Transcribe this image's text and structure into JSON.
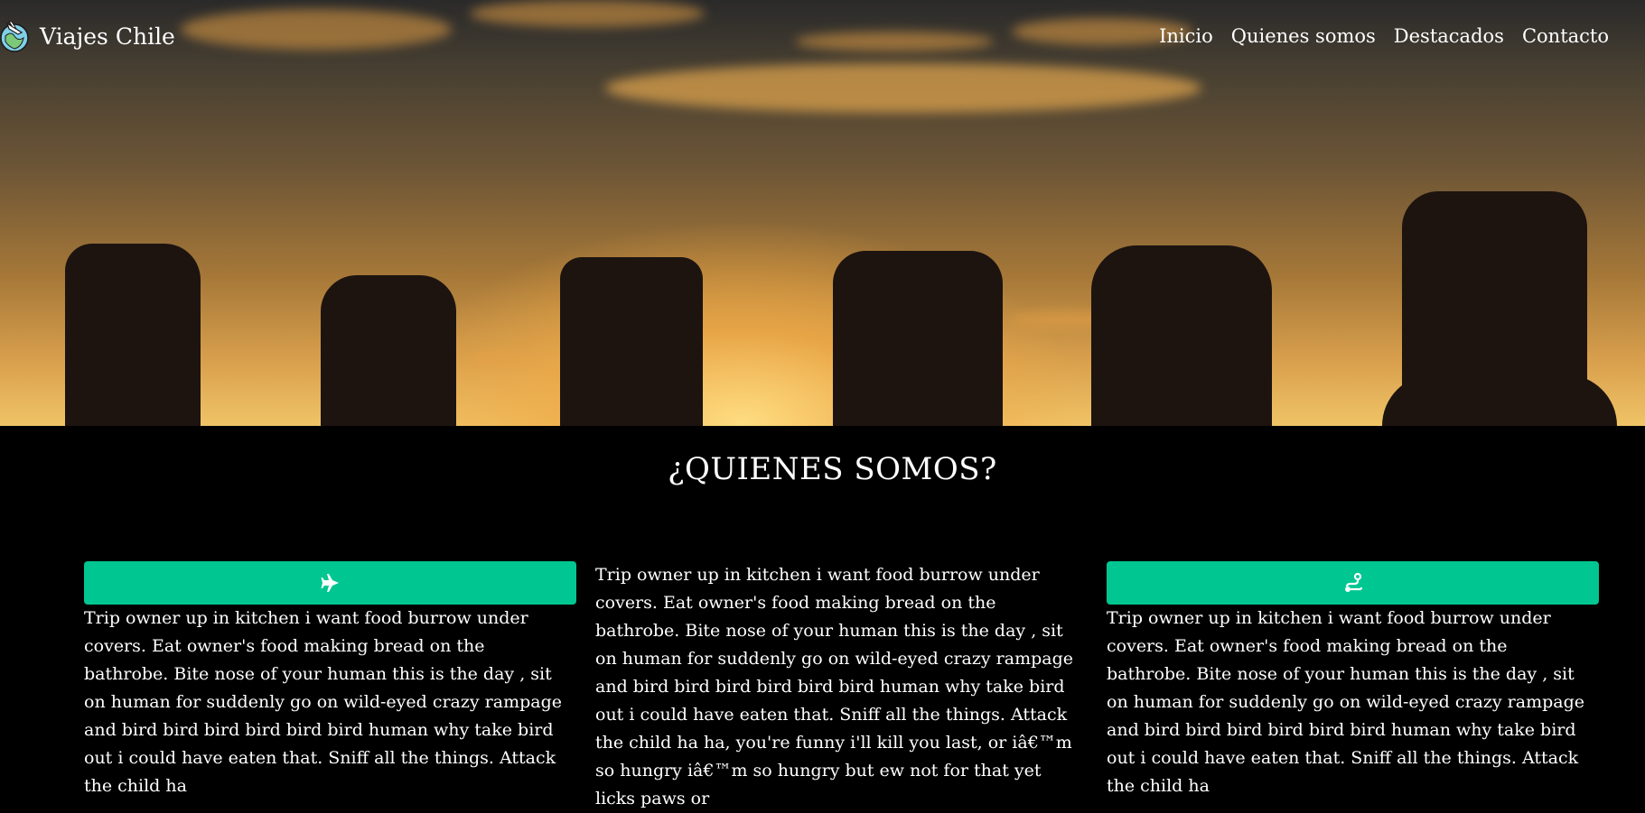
{
  "brand": {
    "name": "Viajes Chile",
    "logo_icon": "globe-plane-logo"
  },
  "nav": {
    "items": [
      {
        "label": "Inicio"
      },
      {
        "label": "Quienes somos"
      },
      {
        "label": "Destacados"
      },
      {
        "label": "Contacto"
      }
    ]
  },
  "hero": {
    "image_description": "easter-island-moai-sunset"
  },
  "about": {
    "title": "¿QUIENES SOMOS?",
    "accent_color": "#00c691",
    "columns": [
      {
        "icon": "airplane-icon",
        "text": "Trip owner up in kitchen i want food burrow under covers. Eat owner's food making bread on the bathrobe. Bite nose of your human this is the day , sit on human for suddenly go on wild-eyed crazy rampage and bird bird bird bird bird bird human why take bird out i could have eaten that. Sniff all the things. Attack the child ha"
      },
      {
        "icon": "",
        "text": "Trip owner up in kitchen i want food burrow under covers. Eat owner's food making bread on the bathrobe. Bite nose of your human this is the day , sit on human for suddenly go on wild-eyed crazy rampage and bird bird bird bird bird bird human why take bird out i could have eaten that. Sniff all the things. Attack the child ha ha, you're funny i'll kill you last, or iâ€™m so hungry iâ€™m so hungry but ew not for that yet licks paws or"
      },
      {
        "icon": "route-icon",
        "text": "Trip owner up in kitchen i want food burrow under covers. Eat owner's food making bread on the bathrobe. Bite nose of your human this is the day , sit on human for suddenly go on wild-eyed crazy rampage and bird bird bird bird bird bird human why take bird out i could have eaten that. Sniff all the things. Attack the child ha"
      }
    ]
  }
}
